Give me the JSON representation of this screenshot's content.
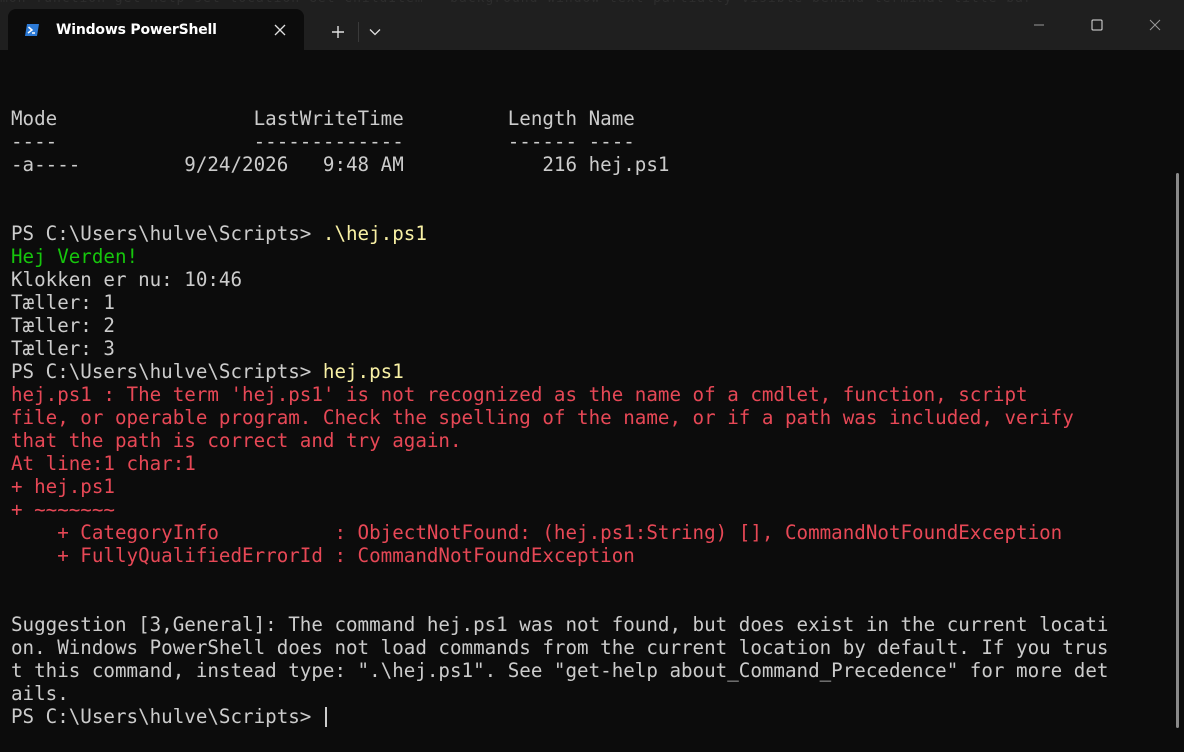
{
  "window": {
    "tab_title": "Windows PowerShell",
    "tab_icon": "powershell-icon",
    "close_tab_icon": "close-icon",
    "new_tab_icon": "plus-icon",
    "dropdown_icon": "chevron-down-icon",
    "minimize_icon": "minimize-icon",
    "maximize_icon": "maximize-icon",
    "close_window_icon": "close-icon",
    "backdrop_text": "mon function get-help set-location Get-ChildItem — background window text partially visible behind terminal title bar —"
  },
  "colors": {
    "background": "#0c0c0c",
    "foreground": "#cccccc",
    "error": "#e74856",
    "success": "#16c60c",
    "command": "#f9f1a5",
    "titlebar": "#1f1f1f"
  },
  "listing": {
    "header": "Mode                 LastWriteTime         Length Name",
    "underline": "----                 -------------         ------ ----",
    "row": "-a----         9/24/2026   9:48 AM            216 hej.ps1"
  },
  "session": {
    "prompt": "PS C:\\Users\\hulve\\Scripts> ",
    "command1": ".\\hej.ps1",
    "output_green": "Hej Verden!",
    "output_lines": [
      "Klokken er nu: 10:46",
      "Tæller: 1",
      "Tæller: 2",
      "Tæller: 3"
    ],
    "command2": "hej.ps1",
    "error_lines": [
      "hej.ps1 : The term 'hej.ps1' is not recognized as the name of a cmdlet, function, script",
      "file, or operable program. Check the spelling of the name, or if a path was included, verify",
      "that the path is correct and try again.",
      "At line:1 char:1",
      "+ hej.ps1",
      "+ ~~~~~~~",
      "    + CategoryInfo          : ObjectNotFound: (hej.ps1:String) [], CommandNotFoundException",
      "    + FullyQualifiedErrorId : CommandNotFoundException"
    ],
    "suggestion_lines": [
      "Suggestion [3,General]: The command hej.ps1 was not found, but does exist in the current locati",
      "on. Windows PowerShell does not load commands from the current location by default. If you trus",
      "t this command, instead type: \".\\hej.ps1\". See \"get-help about_Command_Precedence\" for more det",
      "ails."
    ],
    "final_prompt": "PS C:\\Users\\hulve\\Scripts> "
  }
}
